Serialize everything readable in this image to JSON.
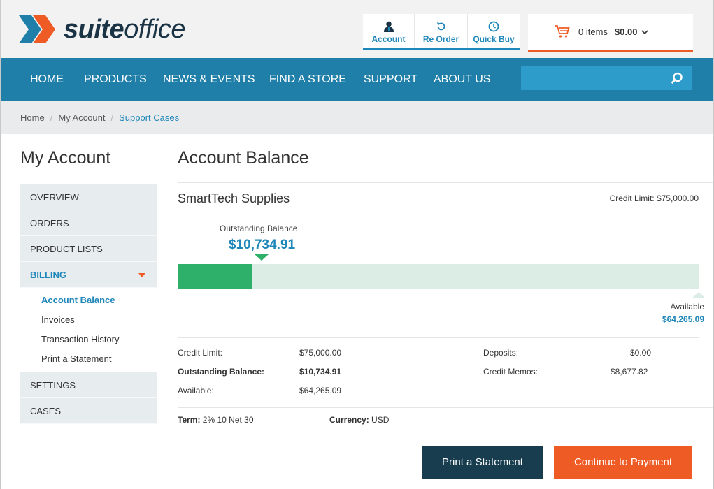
{
  "brand": {
    "name_bold": "suite",
    "name_light": "office"
  },
  "quick_links": [
    {
      "label": "Account",
      "icon": "user-icon"
    },
    {
      "label": "Re Order",
      "icon": "reorder-icon"
    },
    {
      "label": "Quick Buy",
      "icon": "clock-icon"
    }
  ],
  "cart": {
    "items": "0 items",
    "total": "$0.00",
    "icon": "cart-icon"
  },
  "nav": [
    "HOME",
    "PRODUCTS",
    "NEWS & EVENTS",
    "FIND A STORE",
    "SUPPORT",
    "ABOUT US"
  ],
  "search": {
    "placeholder": "",
    "icon": "search-icon"
  },
  "breadcrumb": [
    "Home",
    "My Account",
    "Support Cases"
  ],
  "sidebar": {
    "title": "My Account",
    "items": [
      "OVERVIEW",
      "ORDERS",
      "PRODUCT LISTS",
      "BILLING",
      "SETTINGS",
      "CASES"
    ],
    "billing_sub": [
      "Account Balance",
      "Invoices",
      "Transaction History",
      "Print a Statement"
    ]
  },
  "main": {
    "title": "Account Balance",
    "company": "SmartTech Supplies",
    "credit_limit_top": "Credit Limit: $75,000.00",
    "outstanding_label": "Outstanding Balance",
    "outstanding_value": "$10,734.91",
    "available_label": "Available",
    "available_value": "$64,265.09",
    "used_fraction": 0.1431
  },
  "summary": {
    "credit_limit_label": "Credit Limit:",
    "credit_limit_value": "$75,000.00",
    "outstanding_label": "Outstanding Balance:",
    "outstanding_value": "$10,734.91",
    "available_label": "Available:",
    "available_value": "$64,265.09",
    "deposits_label": "Deposits:",
    "deposits_value": "$0.00",
    "credit_memos_label": "Credit Memos:",
    "credit_memos_value": "$8,677.82",
    "term_label": "Term:",
    "term_value": "2% 10 Net 30",
    "currency_label": "Currency:",
    "currency_value": "USD"
  },
  "buttons": {
    "print": "Print a Statement",
    "continue": "Continue to Payment"
  },
  "colors": {
    "accent_blue": "#1e86b8",
    "nav_blue": "#1f7fa8",
    "orange": "#ef5b24",
    "green": "#2fb06a",
    "dark": "#173d4f"
  }
}
